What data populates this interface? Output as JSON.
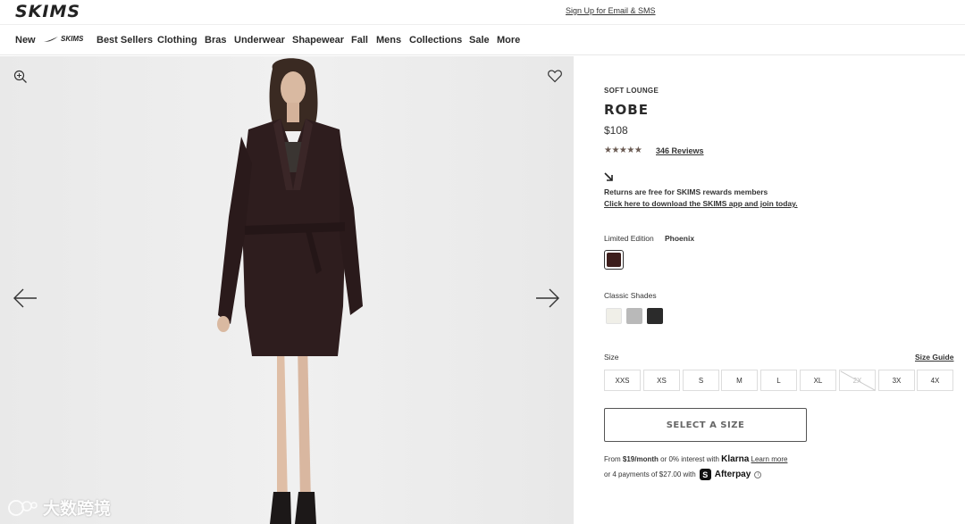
{
  "header": {
    "logo": "SKIMS",
    "signup_link": "Sign Up for Email & SMS"
  },
  "nav": {
    "items": [
      "New",
      "Best Sellers",
      "Clothing",
      "Bras",
      "Underwear",
      "Shapewear",
      "Fall",
      "Mens",
      "Collections",
      "Sale",
      "More"
    ],
    "collab_label": "SKIMS",
    "collab_icon": "nike-swoosh-icon"
  },
  "gallery": {
    "icons": [
      "zoom-icon",
      "heart-icon",
      "arrow-left-icon",
      "arrow-right-icon"
    ],
    "watermark": "大数跨境"
  },
  "product": {
    "category": "SOFT LOUNGE",
    "name": "ROBE",
    "price": "$108",
    "rating_stars": "★★★★★",
    "rating_value": 4.5,
    "reviews": "346 Reviews",
    "returns_text": "Returns are free for SKIMS rewards members",
    "returns_link": "Click here to download the SKIMS app and join today.",
    "limited_edition_label": "Limited Edition",
    "limited_edition_value": "Phoenix",
    "limited_swatch_color": "#3d1e1c",
    "classic_label": "Classic Shades",
    "classic_swatch_colors": [
      "#f0efe8",
      "#b9b9b9",
      "#2b2b2b"
    ],
    "size_label": "Size",
    "size_guide": "Size Guide",
    "sizes": [
      "XXS",
      "XS",
      "S",
      "M",
      "L",
      "XL",
      "2X",
      "3X",
      "4X"
    ],
    "unavailable_size": "2X",
    "cta": "SELECT A SIZE"
  },
  "payments": {
    "klarna_prefix": "From ",
    "klarna_amount": "$19/month",
    "klarna_middle": " or 0% interest with ",
    "klarna_brand": "Klarna",
    "klarna_link": "Learn more",
    "afterpay_prefix": "or 4 payments of $27.00 with",
    "afterpay_badge": "S",
    "afterpay_brand": "Afterpay",
    "info_glyph": "i"
  }
}
